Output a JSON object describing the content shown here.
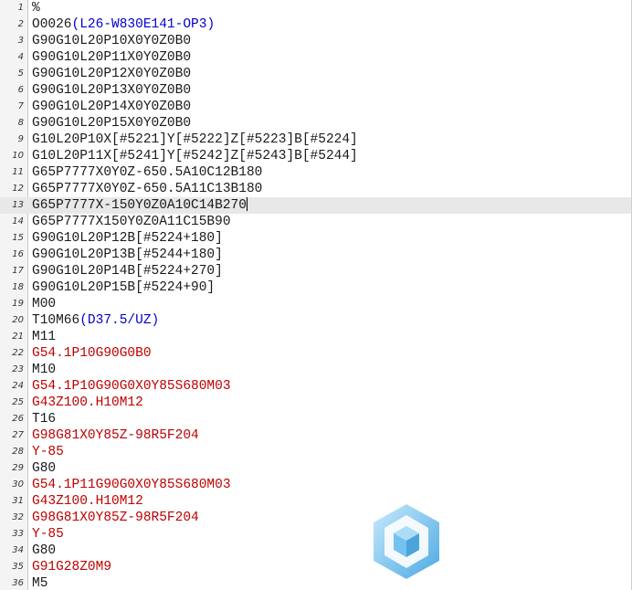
{
  "colors": {
    "default": "#1a1a1a",
    "red": "#c00000",
    "blue": "#0000cc",
    "current_line_bg": "#e8e8e8"
  },
  "editor": {
    "current_line": 13,
    "lines": [
      {
        "n": "1",
        "segs": [
          {
            "t": "%",
            "c": "black"
          }
        ]
      },
      {
        "n": "2",
        "segs": [
          {
            "t": "O0026",
            "c": "black"
          },
          {
            "t": "(L26-W830E141-OP3)",
            "c": "blue"
          }
        ]
      },
      {
        "n": "3",
        "segs": [
          {
            "t": "G90G10L20P10X0Y0Z0B0",
            "c": "black"
          }
        ]
      },
      {
        "n": "4",
        "segs": [
          {
            "t": "G90G10L20P11X0Y0Z0B0",
            "c": "black"
          }
        ]
      },
      {
        "n": "5",
        "segs": [
          {
            "t": "G90G10L20P12X0Y0Z0B0",
            "c": "black"
          }
        ]
      },
      {
        "n": "6",
        "segs": [
          {
            "t": "G90G10L20P13X0Y0Z0B0",
            "c": "black"
          }
        ]
      },
      {
        "n": "7",
        "segs": [
          {
            "t": "G90G10L20P14X0Y0Z0B0",
            "c": "black"
          }
        ]
      },
      {
        "n": "8",
        "segs": [
          {
            "t": "G90G10L20P15X0Y0Z0B0",
            "c": "black"
          }
        ]
      },
      {
        "n": "9",
        "segs": [
          {
            "t": "G10L20P10X[#5221]Y[#5222]Z[#5223]B[#5224]",
            "c": "black"
          }
        ]
      },
      {
        "n": "10",
        "segs": [
          {
            "t": "G10L20P11X[#5241]Y[#5242]Z[#5243]B[#5244]",
            "c": "black"
          }
        ]
      },
      {
        "n": "11",
        "segs": [
          {
            "t": "G65P7777X0Y0Z-650.5A10C12B180",
            "c": "black"
          }
        ]
      },
      {
        "n": "12",
        "segs": [
          {
            "t": "G65P7777X0Y0Z-650.5A11C13B180",
            "c": "black"
          }
        ]
      },
      {
        "n": "13",
        "segs": [
          {
            "t": "G65P7777X-150Y0Z0A10C14B270",
            "c": "black"
          }
        ]
      },
      {
        "n": "14",
        "segs": [
          {
            "t": "G65P7777X150Y0Z0A11C15B90",
            "c": "black"
          }
        ]
      },
      {
        "n": "15",
        "segs": [
          {
            "t": "G90G10L20P12B[#5224+180]",
            "c": "black"
          }
        ]
      },
      {
        "n": "16",
        "segs": [
          {
            "t": "G90G10L20P13B[#5244+180]",
            "c": "black"
          }
        ]
      },
      {
        "n": "17",
        "segs": [
          {
            "t": "G90G10L20P14B[#5224+270]",
            "c": "black"
          }
        ]
      },
      {
        "n": "18",
        "segs": [
          {
            "t": "G90G10L20P15B[#5224+90]",
            "c": "black"
          }
        ]
      },
      {
        "n": "19",
        "segs": [
          {
            "t": "M00",
            "c": "black"
          }
        ]
      },
      {
        "n": "20",
        "segs": [
          {
            "t": "T10M66",
            "c": "black"
          },
          {
            "t": "(D37.5/UZ)",
            "c": "blue"
          }
        ]
      },
      {
        "n": "21",
        "segs": [
          {
            "t": "M11",
            "c": "black"
          }
        ]
      },
      {
        "n": "22",
        "segs": [
          {
            "t": "G54.1P10G90G0B0",
            "c": "red"
          }
        ]
      },
      {
        "n": "23",
        "segs": [
          {
            "t": "M10",
            "c": "black"
          }
        ]
      },
      {
        "n": "24",
        "segs": [
          {
            "t": "G54.1P10G90G0X0Y85S680M03",
            "c": "red"
          }
        ]
      },
      {
        "n": "25",
        "segs": [
          {
            "t": "G43Z100.H10M12",
            "c": "red"
          }
        ]
      },
      {
        "n": "26",
        "segs": [
          {
            "t": "T16",
            "c": "black"
          }
        ]
      },
      {
        "n": "27",
        "segs": [
          {
            "t": "G98G81X0Y85Z-98R5F204",
            "c": "red"
          }
        ]
      },
      {
        "n": "28",
        "segs": [
          {
            "t": "Y-85",
            "c": "red"
          }
        ]
      },
      {
        "n": "29",
        "segs": [
          {
            "t": "G80",
            "c": "black"
          }
        ]
      },
      {
        "n": "30",
        "segs": [
          {
            "t": "G54.1P11G90G0X0Y85S680M03",
            "c": "red"
          }
        ]
      },
      {
        "n": "31",
        "segs": [
          {
            "t": "G43Z100.H10M12",
            "c": "red"
          }
        ]
      },
      {
        "n": "32",
        "segs": [
          {
            "t": "G98G81X0Y85Z-98R5F204",
            "c": "red"
          }
        ]
      },
      {
        "n": "33",
        "segs": [
          {
            "t": "Y-85",
            "c": "red"
          }
        ]
      },
      {
        "n": "34",
        "segs": [
          {
            "t": "G80",
            "c": "black"
          }
        ]
      },
      {
        "n": "35",
        "segs": [
          {
            "t": "G91G28Z0M9",
            "c": "red"
          }
        ]
      },
      {
        "n": "36",
        "segs": [
          {
            "t": "M5",
            "c": "black"
          }
        ]
      }
    ]
  }
}
